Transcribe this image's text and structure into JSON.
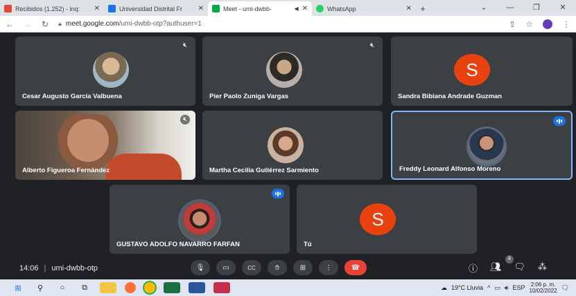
{
  "browser": {
    "tabs": [
      {
        "title": "Recibidos (1.252) - inq:",
        "close": "✕",
        "favicon_color": "#ea4335"
      },
      {
        "title": "Universidad Distrital Fr",
        "close": "✕",
        "favicon_color": "#1a73e8"
      },
      {
        "title": "Meet - umi-dwbb-",
        "close": "✕",
        "favicon_color": "#00ac47",
        "active": true
      },
      {
        "title": "WhatsApp",
        "close": "✕",
        "favicon_color": "#25d366"
      }
    ],
    "new_tab": "+",
    "url_host": "meet.google.com",
    "url_path": "/umi-dwbb-otp?authuser=1"
  },
  "participants": [
    {
      "name": "Cesar Augusto Garcia Valbuena",
      "muted": true
    },
    {
      "name": "Pier Paolo Zuniga Vargas",
      "muted": true
    },
    {
      "name": "Sandra Bibiana Andrade Guzman",
      "initial": "S"
    },
    {
      "name": "Alberto Figueroa Fernández",
      "muted": true
    },
    {
      "name": "Martha Cecilia Gutiérrez Sarmiento"
    },
    {
      "name": "Freddy Leonard Alfonso Moreno",
      "speaking": true
    },
    {
      "name": "GUSTAVO ADOLFO NAVARRO FARFAN",
      "speaking": true
    },
    {
      "name": "Tú",
      "initial": "S"
    }
  ],
  "meeting": {
    "time": "14:06",
    "code": "umi-dwbb-otp",
    "participant_count": "8",
    "colors": {
      "accent": "#8ab4f8",
      "end_call": "#ea4335",
      "avatar": "#e8430f",
      "tile": "#3c4043",
      "background": "#202124"
    }
  },
  "taskbar": {
    "weather": "19°C  Lluvia",
    "language": "ESP",
    "time": "2:06 p. m.",
    "date": "10/02/2022"
  }
}
